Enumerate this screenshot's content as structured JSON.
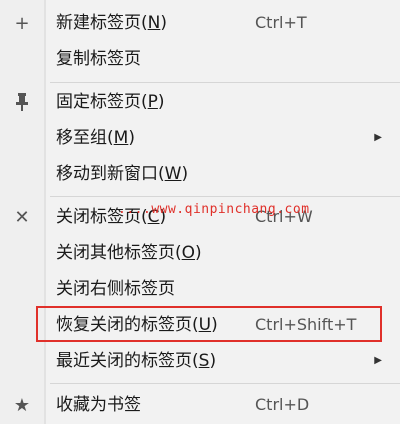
{
  "menu": {
    "items": [
      {
        "icon": "+",
        "label": "新建标签页(",
        "mnemonic": "N",
        "label_end": ")",
        "shortcut": "Ctrl+T"
      },
      {
        "label": "复制标签页"
      },
      {
        "icon": "pin",
        "label": "固定标签页(",
        "mnemonic": "P",
        "label_end": ")"
      },
      {
        "label": "移至组(",
        "mnemonic": "M",
        "label_end": ")",
        "arrow": "▶"
      },
      {
        "label": "移动到新窗口(",
        "mnemonic": "W",
        "label_end": ")"
      },
      {
        "icon": "✕",
        "label": "关闭标签页(",
        "mnemonic": "C",
        "label_end": ")",
        "shortcut": "Ctrl+W"
      },
      {
        "label": "关闭其他标签页(",
        "mnemonic": "O",
        "label_end": ")"
      },
      {
        "label": "关闭右侧标签页"
      },
      {
        "label": "恢复关闭的标签页(",
        "mnemonic": "U",
        "label_end": ")",
        "shortcut": "Ctrl+Shift+T"
      },
      {
        "label": "最近关闭的标签页(",
        "mnemonic": "S",
        "label_end": ")",
        "arrow": "▶"
      },
      {
        "icon": "★",
        "label": "收藏为书签",
        "shortcut": "Ctrl+D"
      }
    ]
  },
  "watermark": {
    "dots": "....",
    "text": "www.qinpinchang.com"
  },
  "colors": {
    "highlight": "#e0302a",
    "background": "#f2f2f2"
  }
}
